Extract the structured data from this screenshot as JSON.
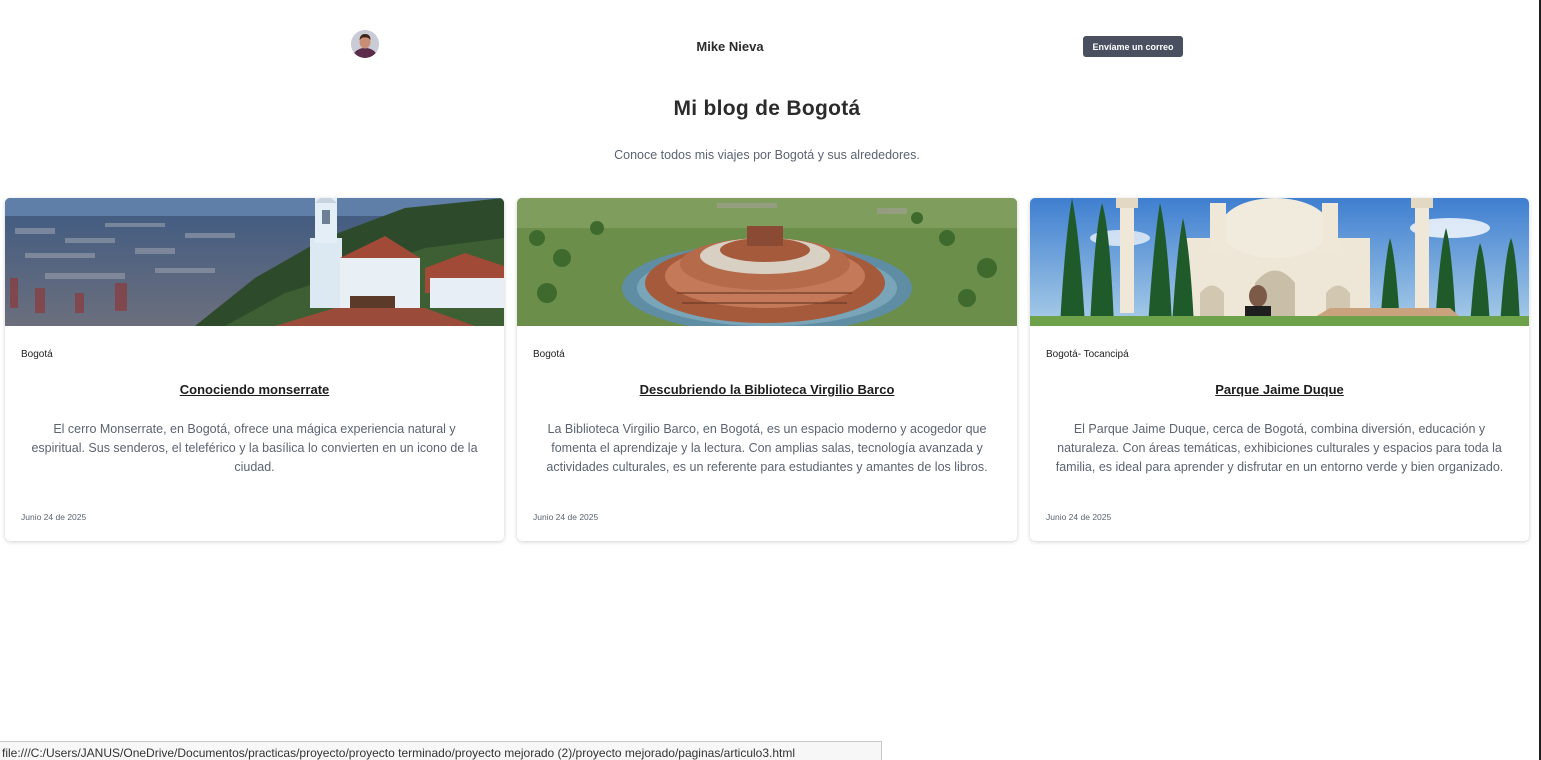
{
  "header": {
    "author_name": "Mike Nieva",
    "email_button_label": "Envíame un correo"
  },
  "blog": {
    "title": "Mi blog de Bogotá",
    "subtitle": "Conoce todos mis viajes por Bogotá y sus alrededores."
  },
  "cards": [
    {
      "category": "Bogotá",
      "title": "Conociendo monserrate",
      "excerpt": "El cerro Monserrate, en Bogotá, ofrece una mágica experiencia natural y espiritual. Sus senderos, el teleférico y la basílica lo convierten en un icono de la ciudad.",
      "date": "Junio 24 de 2025"
    },
    {
      "category": "Bogotá",
      "title": "Descubriendo la Biblioteca Virgilio Barco",
      "excerpt": "La Biblioteca Virgilio Barco, en Bogotá, es un espacio moderno y acogedor que fomenta el aprendizaje y la lectura. Con amplias salas, tecnología avanzada y actividades culturales, es un referente para estudiantes y amantes de los libros.",
      "date": "Junio 24 de 2025"
    },
    {
      "category": "Bogotá- Tocancipá",
      "title": "Parque Jaime Duque",
      "excerpt": "El Parque Jaime Duque, cerca de Bogotá, combina diversión, educación y naturaleza. Con áreas temáticas, exhibiciones culturales y espacios para toda la familia, es ideal para aprender y disfrutar en un entorno verde y bien organizado.",
      "date": "Junio 24 de 2025"
    }
  ],
  "status_bar": {
    "url": "file:///C:/Users/JANUS/OneDrive/Documentos/practicas/proyecto/proyecto terminado/proyecto mejorado (2)/proyecto mejorado/paginas/articulo3.html"
  },
  "colors": {
    "button_bg": "#4a5060",
    "text_dark": "#2b2b2b",
    "text_muted": "#5b6472"
  }
}
